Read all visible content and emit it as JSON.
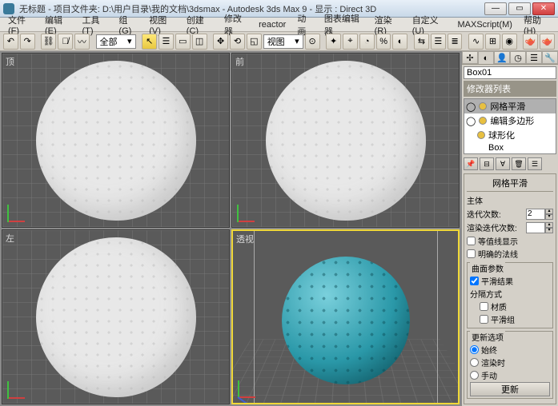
{
  "titlebar": {
    "doc": "无标题",
    "folder": "- 项目文件夹: D:\\用户目录\\我的文档\\3dsmax",
    "app": "- Autodesk 3ds Max 9",
    "display": "- 显示 : Direct 3D"
  },
  "winbtns": {
    "min": "—",
    "max": "▭",
    "close": "✕"
  },
  "menu": [
    "文件(F)",
    "编辑(E)",
    "工具(T)",
    "组(G)",
    "视图(V)",
    "创建(C)",
    "修改器",
    "reactor",
    "动画",
    "图表编辑器",
    "渲染(R)",
    "自定义(U)",
    "MAXScript(M)",
    "帮助(H)"
  ],
  "toolbar": {
    "dd1": "全部",
    "dd2": "视图"
  },
  "viewports": {
    "top": "顶",
    "front": "前",
    "left": "左",
    "persp": "透视"
  },
  "cmdpanel": {
    "objname": "Box01",
    "modlist_hdr": "修改器列表",
    "stack": {
      "i0": "网格平滑",
      "i1": "编辑多边形",
      "i2": "球形化",
      "i3": "Box"
    },
    "params": {
      "hdr": "网格平滑",
      "group_main": "主体",
      "iter_lbl": "迭代次数:",
      "iter_val": "2",
      "render_iter_lbl": "渲染迭代次数:",
      "render_iter_val": "",
      "chk_isoline": "等值线显示",
      "chk_explicit": "明确的法线",
      "group_surf": "曲面参数",
      "chk_smooth": "平滑结果",
      "sep_lbl": "分隔方式",
      "chk_mat": "材质",
      "chk_smgrp": "平滑组",
      "group_update": "更新选项",
      "rad_always": "始终",
      "rad_render": "渲染时",
      "rad_manual": "手动",
      "btn_update": "更新"
    }
  }
}
